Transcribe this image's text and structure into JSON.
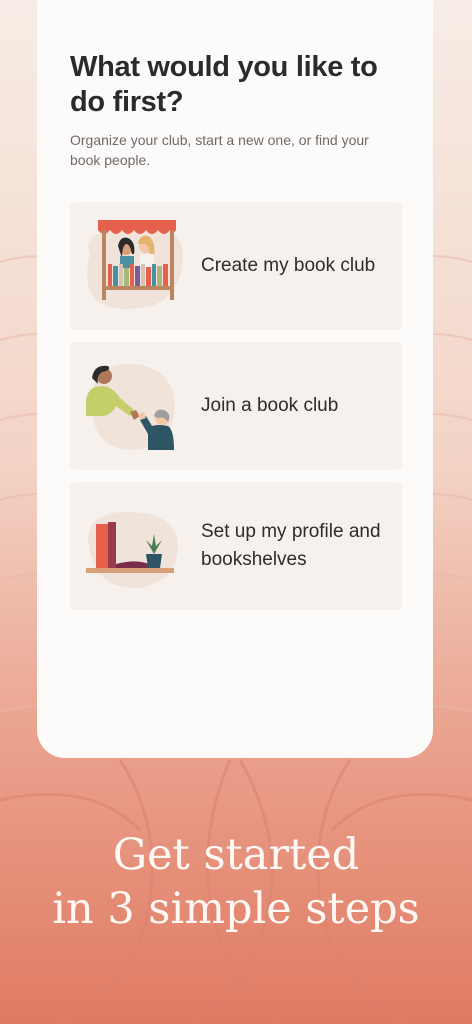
{
  "onboarding": {
    "title": "What would you like to do first?",
    "subtitle": "Organize your club, start a new one, or find your book people.",
    "options": [
      {
        "label": "Create my book club",
        "icon": "bookshop-window-icon"
      },
      {
        "label": "Join a book club",
        "icon": "handshake-icon"
      },
      {
        "label": "Set up my profile and bookshelves",
        "icon": "bookshelf-icon"
      }
    ]
  },
  "promo": {
    "tagline_line1": "Get started",
    "tagline_line2": "in 3 simple steps"
  },
  "colors": {
    "accent": "#e6604e",
    "card_bg": "#fdfbfa",
    "option_bg": "#f6f1ed",
    "text_dark": "#2b2b2b"
  }
}
